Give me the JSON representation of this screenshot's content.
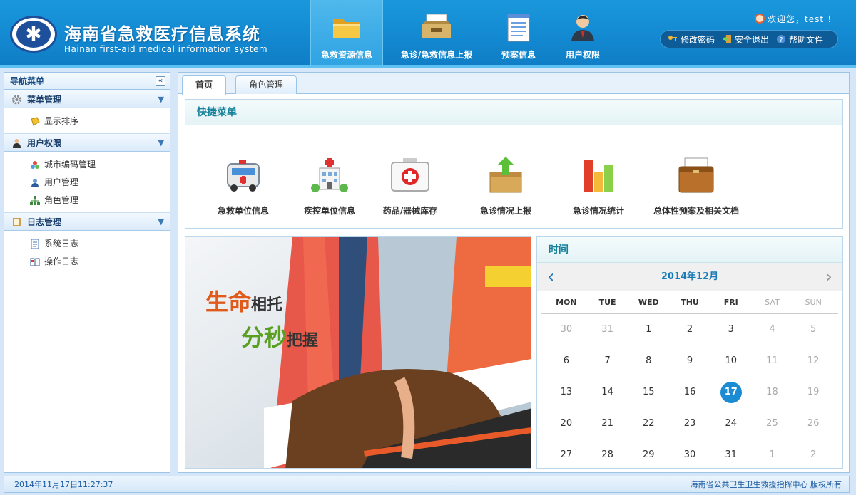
{
  "header": {
    "title_cn": "海南省急救医疗信息系统",
    "title_en": "Hainan first-aid medical information system",
    "nav": [
      {
        "label": "急救资源信息",
        "icon": "folder-icon",
        "active": true
      },
      {
        "label": "急诊/急救信息上报",
        "icon": "inbox-tray-icon",
        "active": false
      },
      {
        "label": "预案信息",
        "icon": "notepad-icon",
        "active": false
      },
      {
        "label": "用户权限",
        "icon": "user-icon",
        "active": false
      }
    ],
    "welcome": "欢迎您，test ！",
    "toolbar": {
      "change_password": "修改密码",
      "logout": "安全退出",
      "help": "帮助文件"
    }
  },
  "sidebar": {
    "title": "导航菜单",
    "collapse_label": "«",
    "groups": [
      {
        "label": "菜单管理",
        "icon": "gear-icon",
        "items": [
          {
            "label": "显示排序",
            "icon": "tag-icon"
          }
        ]
      },
      {
        "label": "用户权限",
        "icon": "user-icon",
        "items": [
          {
            "label": "城市编码管理",
            "icon": "color-dots-icon"
          },
          {
            "label": "用户管理",
            "icon": "user-icon"
          },
          {
            "label": "角色管理",
            "icon": "org-chart-icon"
          }
        ]
      },
      {
        "label": "日志管理",
        "icon": "book-icon",
        "items": [
          {
            "label": "系统日志",
            "icon": "document-icon"
          },
          {
            "label": "操作日志",
            "icon": "open-book-icon"
          }
        ]
      }
    ]
  },
  "tabs": [
    {
      "label": "首页",
      "active": true
    },
    {
      "label": "角色管理",
      "active": false
    }
  ],
  "quick_menu": {
    "title": "快捷菜单",
    "items": [
      {
        "label": "急救单位信息",
        "icon": "ambulance-icon"
      },
      {
        "label": "疾控单位信息",
        "icon": "hospital-icon"
      },
      {
        "label": "药品/器械库存",
        "icon": "first-aid-kit-icon"
      },
      {
        "label": "急诊情况上报",
        "icon": "upload-box-icon"
      },
      {
        "label": "急诊情况统计",
        "icon": "bar-chart-icon"
      },
      {
        "label": "总体性预案及相关文档",
        "icon": "briefcase-icon"
      }
    ]
  },
  "banner": {
    "line1_a": "生命",
    "line1_b": "相托",
    "line2_a": "分秒",
    "line2_b": "把握"
  },
  "calendar": {
    "title": "时间",
    "month_label": "2014年12月",
    "weekdays": [
      "MON",
      "TUE",
      "WED",
      "THU",
      "FRI",
      "SAT",
      "SUN"
    ],
    "weeks": [
      [
        "30",
        "31",
        "1",
        "2",
        "3",
        "4",
        "5"
      ],
      [
        "6",
        "7",
        "8",
        "9",
        "10",
        "11",
        "12"
      ],
      [
        "13",
        "14",
        "15",
        "16",
        "17",
        "18",
        "19"
      ],
      [
        "20",
        "21",
        "22",
        "23",
        "24",
        "25",
        "26"
      ],
      [
        "27",
        "28",
        "29",
        "30",
        "31",
        "1",
        "2"
      ]
    ],
    "today": "17",
    "colors": {
      "accent": "#1b8bd4",
      "muted": "#aaaaaa"
    }
  },
  "footer": {
    "datetime": "2014年11月17日11:27:37",
    "copyright": "海南省公共卫生卫生救援指挥中心 版权所有"
  }
}
